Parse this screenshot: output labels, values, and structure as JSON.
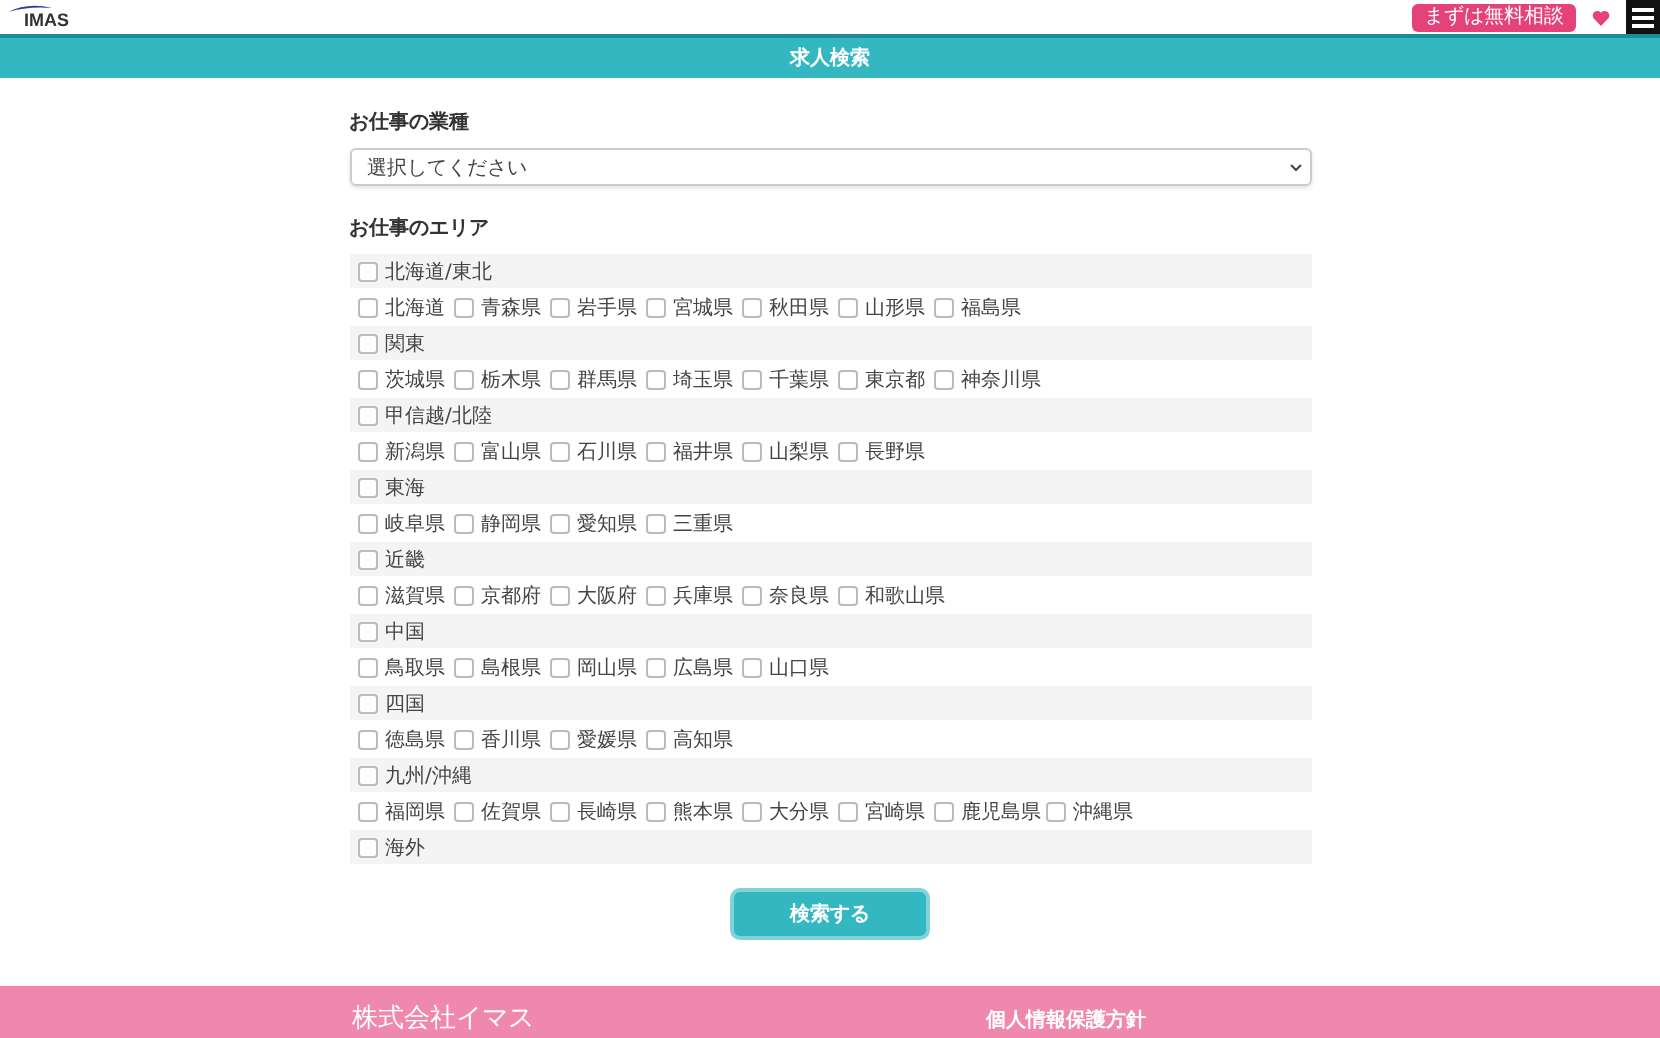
{
  "header": {
    "logo": "IMAS",
    "consult_button": "まずは無料相談"
  },
  "title_bar": {
    "title": "求人検索"
  },
  "job_type": {
    "heading": "お仕事の業種",
    "select": {
      "value": "選択してください"
    }
  },
  "area": {
    "heading": "お仕事のエリア",
    "regions": [
      {
        "label": "北海道/東北",
        "checked": false,
        "children": [
          {
            "label": "北海道",
            "checked": false
          },
          {
            "label": "青森県",
            "checked": false
          },
          {
            "label": "岩手県",
            "checked": false
          },
          {
            "label": "宮城県",
            "checked": false
          },
          {
            "label": "秋田県",
            "checked": false
          },
          {
            "label": "山形県",
            "checked": false
          },
          {
            "label": "福島県",
            "checked": false
          }
        ]
      },
      {
        "label": "関東",
        "checked": false,
        "children": [
          {
            "label": "茨城県",
            "checked": false
          },
          {
            "label": "栃木県",
            "checked": false
          },
          {
            "label": "群馬県",
            "checked": false
          },
          {
            "label": "埼玉県",
            "checked": false
          },
          {
            "label": "千葉県",
            "checked": false
          },
          {
            "label": "東京都",
            "checked": false
          },
          {
            "label": "神奈川県",
            "checked": false
          }
        ]
      },
      {
        "label": "甲信越/北陸",
        "checked": false,
        "children": [
          {
            "label": "新潟県",
            "checked": false
          },
          {
            "label": "富山県",
            "checked": false
          },
          {
            "label": "石川県",
            "checked": false
          },
          {
            "label": "福井県",
            "checked": false
          },
          {
            "label": "山梨県",
            "checked": false
          },
          {
            "label": "長野県",
            "checked": false
          }
        ]
      },
      {
        "label": "東海",
        "checked": false,
        "children": [
          {
            "label": "岐阜県",
            "checked": false
          },
          {
            "label": "静岡県",
            "checked": false
          },
          {
            "label": "愛知県",
            "checked": false
          },
          {
            "label": "三重県",
            "checked": false
          }
        ]
      },
      {
        "label": "近畿",
        "checked": false,
        "children": [
          {
            "label": "滋賀県",
            "checked": false
          },
          {
            "label": "京都府",
            "checked": false
          },
          {
            "label": "大阪府",
            "checked": false
          },
          {
            "label": "兵庫県",
            "checked": false
          },
          {
            "label": "奈良県",
            "checked": false
          },
          {
            "label": "和歌山県",
            "checked": false
          }
        ]
      },
      {
        "label": "中国",
        "checked": false,
        "children": [
          {
            "label": "鳥取県",
            "checked": false
          },
          {
            "label": "島根県",
            "checked": false
          },
          {
            "label": "岡山県",
            "checked": false
          },
          {
            "label": "広島県",
            "checked": false
          },
          {
            "label": "山口県",
            "checked": false
          }
        ]
      },
      {
        "label": "四国",
        "checked": false,
        "children": [
          {
            "label": "徳島県",
            "checked": false
          },
          {
            "label": "香川県",
            "checked": false
          },
          {
            "label": "愛媛県",
            "checked": false
          },
          {
            "label": "高知県",
            "checked": false
          }
        ]
      },
      {
        "label": "九州/沖縄",
        "checked": false,
        "children": [
          {
            "label": "福岡県",
            "checked": false
          },
          {
            "label": "佐賀県",
            "checked": false
          },
          {
            "label": "長崎県",
            "checked": false
          },
          {
            "label": "熊本県",
            "checked": false
          },
          {
            "label": "大分県",
            "checked": false
          },
          {
            "label": "宮崎県",
            "checked": false
          },
          {
            "label": "鹿児島県",
            "checked": false
          },
          {
            "label": "沖縄県",
            "checked": false
          }
        ]
      },
      {
        "label": "海外",
        "checked": false
      }
    ]
  },
  "search_button": "検索する",
  "footer": {
    "company": "株式会社イマス",
    "privacy_link": "個人情報保護方針"
  }
}
